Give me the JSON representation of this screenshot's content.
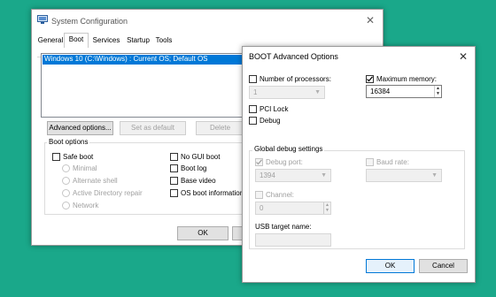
{
  "syscfg": {
    "title": "System Configuration",
    "tabs": [
      "General",
      "Boot",
      "Services",
      "Startup",
      "Tools"
    ],
    "os_entry": "Windows 10 (C:\\Windows) : Current OS; Default OS",
    "buttons": {
      "advanced": "Advanced options...",
      "set_default": "Set as default",
      "delete": "Delete",
      "ok": "OK"
    },
    "boot_options": {
      "group_label": "Boot options",
      "safe_boot": "Safe boot",
      "minimal": "Minimal",
      "alternate_shell": "Alternate shell",
      "active_directory_repair": "Active Directory repair",
      "network": "Network",
      "no_gui_boot": "No GUI boot",
      "boot_log": "Boot log",
      "base_video": "Base video",
      "os_boot_information": "OS boot information"
    }
  },
  "advanced": {
    "title": "BOOT Advanced Options",
    "number_of_processors": {
      "label": "Number of processors:",
      "value": "1",
      "checked": false
    },
    "maximum_memory": {
      "label": "Maximum memory:",
      "value": "16384",
      "checked": true
    },
    "pci_lock": {
      "label": "PCI Lock",
      "checked": false
    },
    "debug": {
      "label": "Debug",
      "checked": false
    },
    "global_debug": {
      "label": "Global debug settings",
      "debug_port": {
        "label": "Debug port:",
        "value": "1394",
        "checked": true
      },
      "baud_rate": {
        "label": "Baud rate:",
        "value": "",
        "checked": false
      },
      "channel": {
        "label": "Channel:",
        "value": "0",
        "checked": false
      },
      "usb_target_name": {
        "label": "USB target name:",
        "value": ""
      }
    },
    "buttons": {
      "ok": "OK",
      "cancel": "Cancel"
    }
  },
  "colors": {
    "background": "#1aa88a",
    "accent": "#0078d7"
  }
}
